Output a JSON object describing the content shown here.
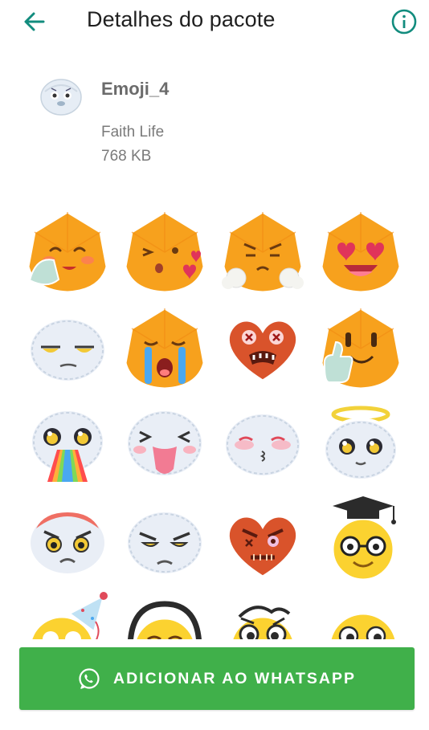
{
  "header": {
    "title": "Detalhes do pacote",
    "back_icon": "arrow-back-icon",
    "info_icon": "info-icon"
  },
  "pack": {
    "name": "Emoji_4",
    "publisher": "Faith Life",
    "size": "768 KB"
  },
  "stickers": [
    {
      "name": "orange-blush-shy"
    },
    {
      "name": "orange-kiss-hearts"
    },
    {
      "name": "orange-angry-steam"
    },
    {
      "name": "orange-heart-eyes"
    },
    {
      "name": "fluffy-side-eye"
    },
    {
      "name": "orange-crying"
    },
    {
      "name": "heart-dizzy"
    },
    {
      "name": "orange-thumbs-up"
    },
    {
      "name": "fluffy-rainbow-vomit"
    },
    {
      "name": "fluffy-tongue-out"
    },
    {
      "name": "fluffy-blush-kiss"
    },
    {
      "name": "fluffy-angel"
    },
    {
      "name": "fluffy-angry-red"
    },
    {
      "name": "fluffy-angry"
    },
    {
      "name": "heart-angry"
    },
    {
      "name": "yellow-nerd-graduate"
    },
    {
      "name": "yellow-party-hat"
    },
    {
      "name": "yellow-headphones"
    },
    {
      "name": "yellow-confused"
    },
    {
      "name": "yellow-surprised"
    }
  ],
  "colors": {
    "accent": "#128c7e",
    "button": "#40b04a",
    "orange": "#f7a11d",
    "yellow": "#fbd230",
    "fluffy": "#e9eef6",
    "heart": "#d9532b"
  },
  "add_button": {
    "label": "ADICIONAR AO WHATSAPP",
    "icon": "whatsapp-icon"
  }
}
